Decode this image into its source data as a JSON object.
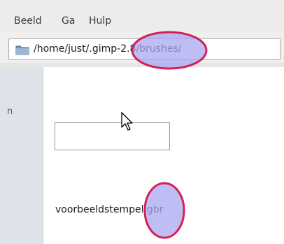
{
  "menubar": {
    "items": [
      {
        "label": "Beeld"
      },
      {
        "label": "Ga"
      },
      {
        "label": "Hulp"
      }
    ]
  },
  "location": {
    "path": "/home/just/.gimp-2.8/brushes/",
    "icon": "folder-icon"
  },
  "sidebar": {
    "partial_label": "n"
  },
  "files": [
    {
      "name": "voorbeeldstempel.gbr"
    }
  ],
  "annotations": {
    "highlight_color_fill": "#a8a8f0",
    "highlight_color_stroke": "#d41f5a"
  }
}
